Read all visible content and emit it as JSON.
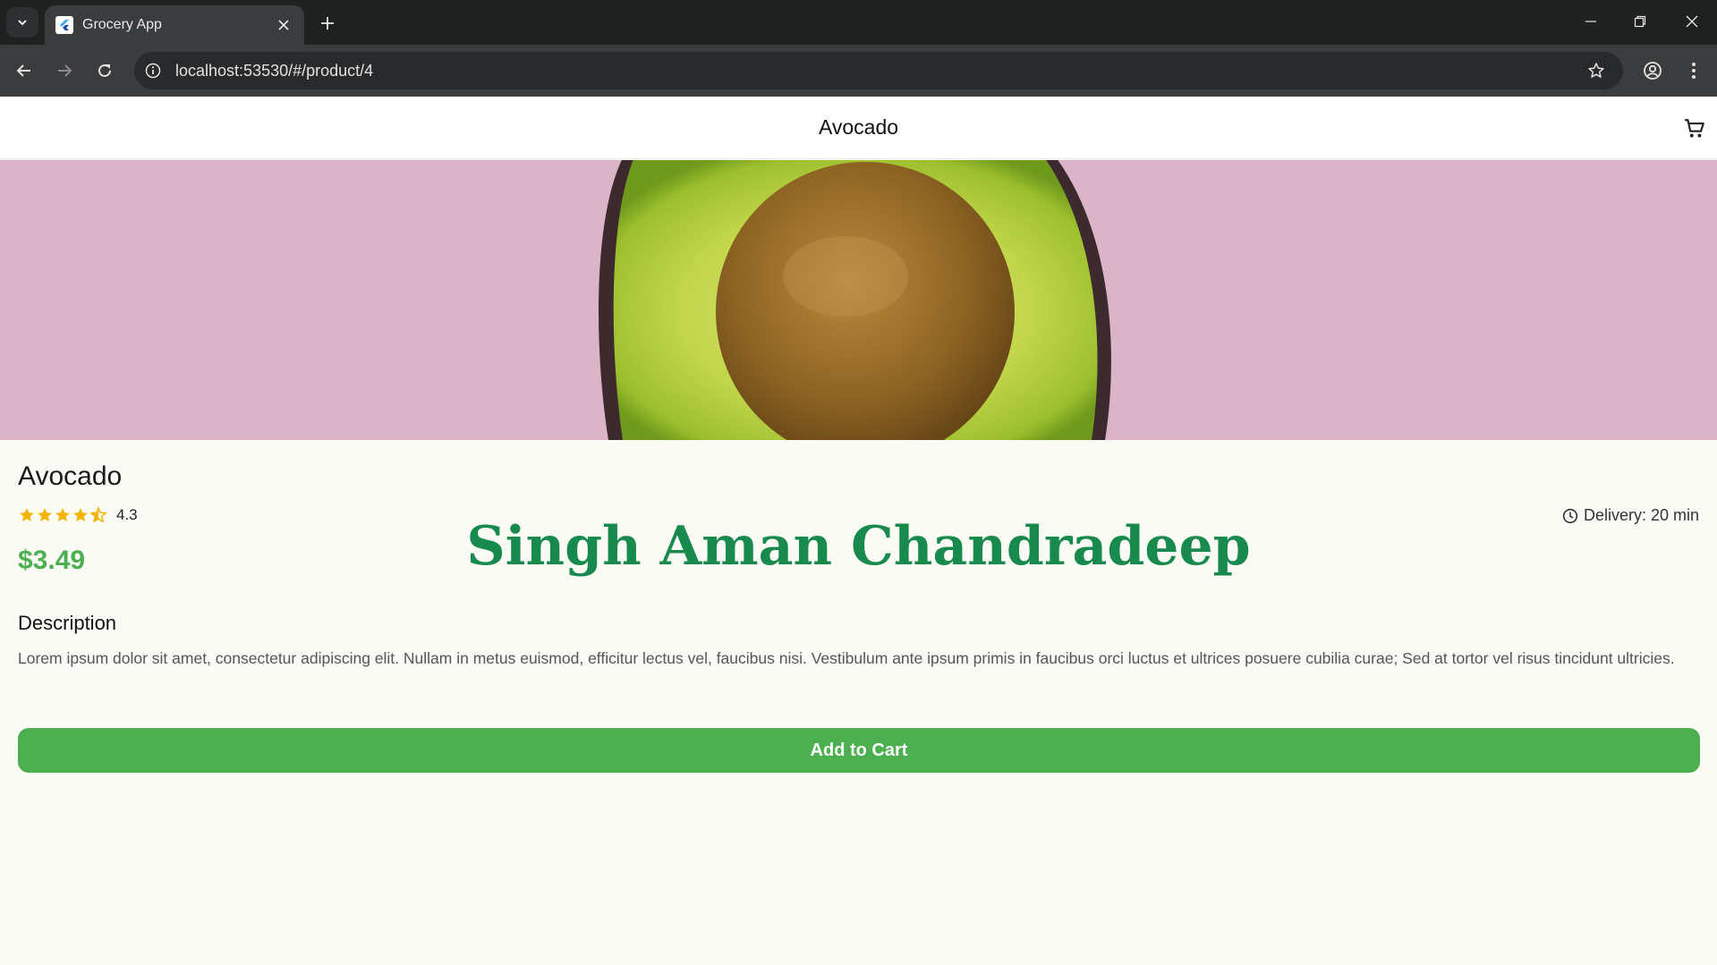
{
  "browser": {
    "tab_title": "Grocery App",
    "url": "localhost:53530/#/product/4",
    "icons": [
      "tab-search-icon",
      "flutter-icon",
      "close-icon",
      "plus-icon",
      "minimize-icon",
      "restore-icon",
      "close-window-icon",
      "back-icon",
      "forward-icon",
      "reload-icon",
      "info-icon",
      "star-icon",
      "profile-icon",
      "menu-icon"
    ]
  },
  "appbar": {
    "title": "Avocado",
    "cart_icon": "cart-icon"
  },
  "product": {
    "name": "Avocado",
    "rating": "4.3",
    "rating_value": 4.3,
    "rating_max": 5,
    "delivery": "Delivery: 20 min",
    "price": "$3.49",
    "description_heading": "Description",
    "description": "Lorem ipsum dolor sit amet, consectetur adipiscing elit. Nullam in metus euismod, efficitur lectus vel, faucibus nisi. Vestibulum ante ipsum primis in faucibus orci luctus et ultrices posuere cubilia curae; Sed at tortor vel risus tincidunt ultricies.",
    "add_to_cart": "Add to Cart"
  },
  "overlay": {
    "watermark": "Singh Aman Chandradeep"
  },
  "colors": {
    "accent": "#4caf50",
    "star": "#f4b400",
    "watermark": "#188a4e",
    "hero_bg": "#dcb4c8"
  }
}
